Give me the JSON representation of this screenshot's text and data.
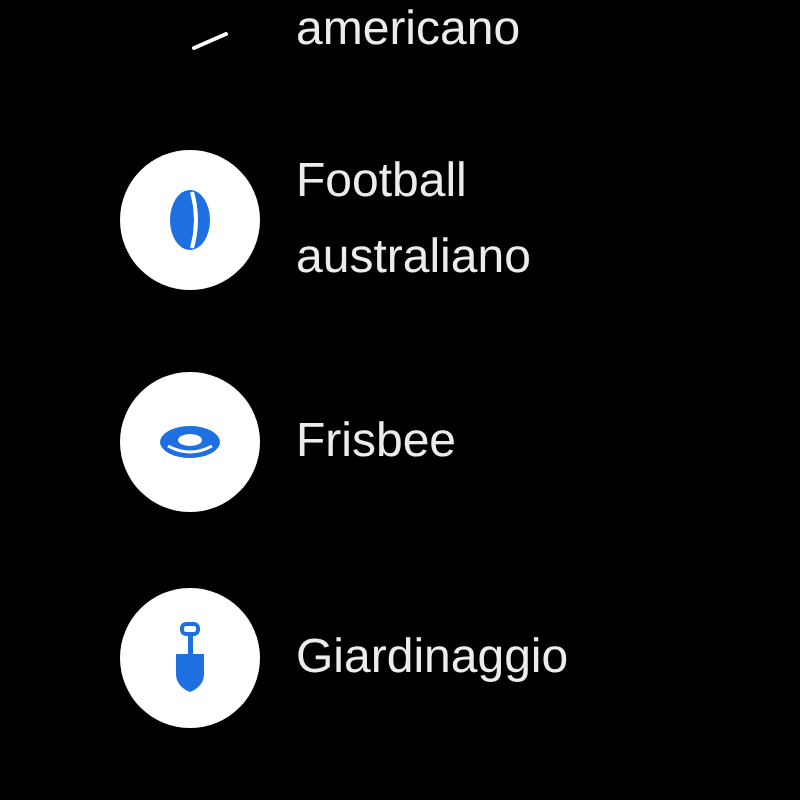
{
  "items": [
    {
      "kind": "partial",
      "lines": [
        "americano"
      ]
    },
    {
      "kind": "oval-ball",
      "lines": [
        "Football",
        "australiano"
      ]
    },
    {
      "kind": "disc",
      "lines": [
        "Frisbee"
      ]
    },
    {
      "kind": "shovel",
      "lines": [
        "Giardinaggio"
      ]
    }
  ]
}
